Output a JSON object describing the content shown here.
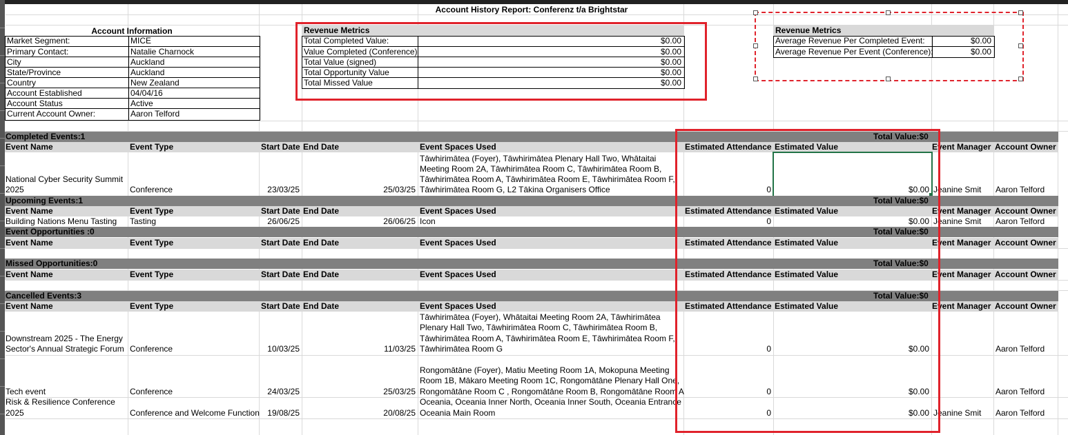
{
  "report_title": "Account History Report: Conferenz t/a Brightstar",
  "account_info": {
    "header": "Account Information",
    "rows": [
      {
        "label": "Market Segment:",
        "value": "MICE"
      },
      {
        "label": "Primary Contact:",
        "value": "Natalie Charnock"
      },
      {
        "label": "City",
        "value": "Auckland"
      },
      {
        "label": "State/Province",
        "value": "Auckland"
      },
      {
        "label": "Country",
        "value": "New Zealand"
      },
      {
        "label": "Account Established",
        "value": "04/04/16"
      },
      {
        "label": "Account Status",
        "value": "Active"
      },
      {
        "label": "Current Account Owner:",
        "value": "Aaron Telford"
      }
    ]
  },
  "revenue_metrics": {
    "header": "Revenue Metrics",
    "rows": [
      {
        "label": "Total Completed Value:",
        "value": "$0.00"
      },
      {
        "label": "Value Completed (Conference)",
        "value": "$0.00"
      },
      {
        "label": "Total Value (signed)",
        "value": "$0.00"
      },
      {
        "label": "Total Opportunity Value",
        "value": "$0.00"
      },
      {
        "label": "Total Missed Value",
        "value": "$0.00"
      }
    ]
  },
  "revenue_metrics_avg": {
    "header": "Revenue Metrics",
    "rows": [
      {
        "label": "Average Revenue Per Completed Event:",
        "value": "$0.00"
      },
      {
        "label": "Average Revenue Per Event (Conference):",
        "value": "$0.00"
      }
    ]
  },
  "columns": {
    "event_name": "Event Name",
    "event_type": "Event Type",
    "start_date": "Start Date",
    "end_date": "End Date",
    "spaces": "Event Spaces Used",
    "attendance": "Estimated Attendance",
    "value": "Estimated Value",
    "manager": "Event Manager",
    "owner": "Account Owner"
  },
  "sections": {
    "completed": {
      "title": "Completed Events:1",
      "total": "Total Value:$0"
    },
    "upcoming": {
      "title": "Upcoming Events:1",
      "total": "Total Value:$0"
    },
    "opportunities": {
      "title": "Event Opportunities :0",
      "total": "Total Value:$0"
    },
    "missed": {
      "title": "Missed Opportunities:0",
      "total": "Total Value:$0"
    },
    "cancelled": {
      "title": "Cancelled Events:3",
      "total": "Total Value:$0"
    }
  },
  "events": {
    "completed_1": {
      "name_l1": "National Cyber Security Summit",
      "name_l2": "2025",
      "type": "Conference",
      "start": "23/03/25",
      "end": "25/03/25",
      "spaces": [
        "Tāwhirimātea (Foyer), Tāwhirimātea  Plenary Hall Two, Whātaitai",
        "Meeting Room 2A, Tāwhirimātea Room C, Tāwhirimātea Room B,",
        "Tāwhirimātea Room A, Tāwhirimātea Room E, Tāwhirimātea Room F,",
        "Tāwhirimātea Room G, L2 Tākina Organisers Office"
      ],
      "attendance": "0",
      "value": "$0.00",
      "manager": "Jeanine Smit",
      "owner": "Aaron Telford"
    },
    "upcoming_1": {
      "name": "Building Nations Menu Tasting",
      "type": "Tasting",
      "start": "26/06/25",
      "end": "26/06/25",
      "spaces": "Icon",
      "attendance": "0",
      "value": "$0.00",
      "manager": "Jeanine Smit",
      "owner": "Aaron Telford"
    },
    "cancelled_1": {
      "name_l1": "Downstream 2025 - The Energy",
      "name_l2": "Sector's Annual Strategic Forum",
      "type": "Conference",
      "start": "10/03/25",
      "end": "11/03/25",
      "spaces": [
        "Tāwhirimātea (Foyer), Whātaitai Meeting Room 2A, Tāwhirimātea",
        "Plenary Hall Two, Tāwhirimātea Room C, Tāwhirimātea Room B,",
        "Tāwhirimātea Room A, Tāwhirimātea Room E, Tāwhirimātea Room F,",
        "Tāwhirimātea Room G"
      ],
      "attendance": "0",
      "value": "$0.00",
      "owner": "Aaron Telford"
    },
    "cancelled_2": {
      "name": "Tech event",
      "type": "Conference",
      "start": "24/03/25",
      "end": "25/03/25",
      "spaces": [
        "Rongomātāne (Foyer), Matiu Meeting Room 1A, Mokopuna Meeting",
        "Room 1B, Mākaro Meeting Room 1C, Rongomātāne Plenary Hall One,",
        "Rongomātāne Room C , Rongomātāne Room B, Rongomātāne Room A"
      ],
      "attendance": "0",
      "value": "$0.00",
      "owner": "Aaron Telford"
    },
    "cancelled_3": {
      "name_l1": "Risk & Resilience Conference",
      "name_l2": "2025",
      "type": "Conference and Welcome Function",
      "start": "19/08/25",
      "end": "20/08/25",
      "spaces": [
        "Oceania, Oceania Inner North, Oceania Inner South, Oceania Entrance",
        "Oceania Main Room"
      ],
      "attendance": "0",
      "value": "$0.00",
      "manager": "Jeanine Smit",
      "owner": "Aaron Telford"
    }
  },
  "colors": {
    "section_bar": "#808080",
    "column_header": "#d9d9d9",
    "highlight_red": "#e0222b",
    "selection_green": "#217346"
  }
}
